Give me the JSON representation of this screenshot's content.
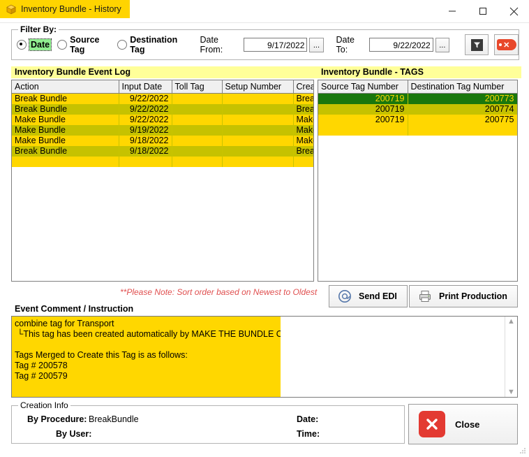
{
  "window": {
    "title": "Inventory Bundle - History",
    "icon": "package-icon",
    "controls": {
      "minimize": "minimize-icon",
      "maximize": "maximize-icon",
      "close": "close-icon"
    }
  },
  "filter": {
    "legend": "Filter By:",
    "options": [
      {
        "label": "Date",
        "selected": true
      },
      {
        "label": "Source Tag",
        "selected": false
      },
      {
        "label": "Destination Tag",
        "selected": false
      }
    ],
    "date_from_label": "Date From:",
    "date_from_value": "9/17/2022",
    "date_to_label": "Date To:",
    "date_to_value": "9/22/2022",
    "browse_label": "...",
    "apply_filter_icon": "funnel-icon",
    "clear_filter_icon": "red-x-tag-icon"
  },
  "event_log": {
    "header": "Inventory Bundle Event Log",
    "columns": [
      "Action",
      "Input Date",
      "Toll Tag",
      "Setup Number",
      "Creat"
    ],
    "rows": [
      {
        "action": "Break Bundle",
        "input_date": "9/22/2022",
        "toll_tag": "",
        "setup_number": "",
        "created": "Break"
      },
      {
        "action": "Break Bundle",
        "input_date": "9/22/2022",
        "toll_tag": "",
        "setup_number": "",
        "created": "Break"
      },
      {
        "action": "Make Bundle",
        "input_date": "9/22/2022",
        "toll_tag": "",
        "setup_number": "",
        "created": "Make"
      },
      {
        "action": "Make Bundle",
        "input_date": "9/19/2022",
        "toll_tag": "",
        "setup_number": "",
        "created": "Make"
      },
      {
        "action": "Make Bundle",
        "input_date": "9/18/2022",
        "toll_tag": "",
        "setup_number": "",
        "created": "Make"
      },
      {
        "action": "Break Bundle",
        "input_date": "9/18/2022",
        "toll_tag": "",
        "setup_number": "",
        "created": "Break"
      }
    ],
    "note": "**Please Note: Sort order based on Newest to Oldest"
  },
  "tags": {
    "header": "Inventory Bundle - TAGS",
    "columns": [
      "Source Tag Number",
      "Destination Tag Number"
    ],
    "rows": [
      {
        "source": "200719",
        "destination": "200773",
        "selected": true
      },
      {
        "source": "200719",
        "destination": "200774",
        "selected": false
      },
      {
        "source": "200719",
        "destination": "200775",
        "selected": false
      }
    ]
  },
  "actions": {
    "send_edi": "Send EDI",
    "send_edi_icon": "at-sign-icon",
    "print_production": "Print Production",
    "print_icon": "printer-icon"
  },
  "comment": {
    "header": "Event Comment / Instruction",
    "text": "combine tag for Transport\n └This tag has been created automatically by MAKE THE BUNDLE Option.\n\nTags Merged to Create this Tag is as follows:\nTag # 200578\nTag # 200579",
    "scroll_up_icon": "chevron-up-icon",
    "scroll_down_icon": "chevron-down-icon"
  },
  "creation_info": {
    "legend": "Creation Info",
    "by_procedure_label": "By Procedure:",
    "by_procedure_value": "BreakBundle",
    "by_user_label": "By User:",
    "by_user_value": "",
    "date_label": "Date:",
    "date_value": "",
    "time_label": "Time:",
    "time_value": ""
  },
  "close": {
    "label": "Close",
    "icon": "red-x-circle-icon"
  },
  "colors": {
    "row_odd": "#FFD700",
    "row_even": "#C6C200",
    "row_selected": "#19770D",
    "header_bar": "#FFFF99",
    "title_tab": "#FFD400",
    "note_red": "#E05050",
    "radio_highlight": "#90EE90",
    "close_red": "#E33A32"
  }
}
